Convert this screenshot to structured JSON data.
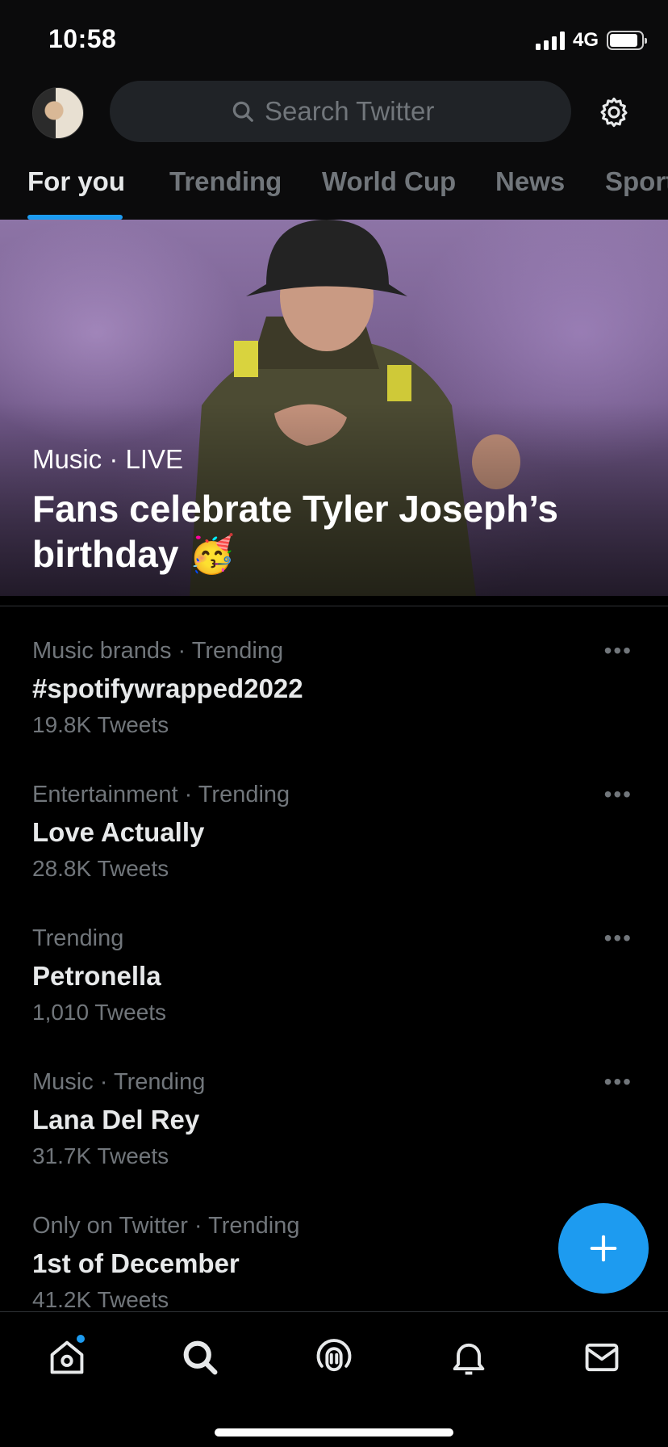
{
  "status_bar": {
    "time": "10:58",
    "network": "4G"
  },
  "header": {
    "search_placeholder": "Search Twitter",
    "tabs": [
      "For you",
      "Trending",
      "World Cup",
      "News",
      "Sport"
    ]
  },
  "hero": {
    "category": "Music",
    "status": "LIVE",
    "meta": "Music · LIVE",
    "title": "Fans celebrate Tyler Joseph’s birthday 🥳"
  },
  "trends": [
    {
      "meta": "Music brands · Trending",
      "title": "#spotifywrapped2022",
      "count": "19.8K Tweets"
    },
    {
      "meta": "Entertainment · Trending",
      "title": "Love Actually",
      "count": "28.8K Tweets"
    },
    {
      "meta": "Trending",
      "title": "Petronella",
      "count": "1,010 Tweets"
    },
    {
      "meta": "Music · Trending",
      "title": "Lana Del Rey",
      "count": "31.7K Tweets"
    },
    {
      "meta": "Only on Twitter · Trending",
      "title": "1st of December",
      "count": "41.2K Tweets"
    }
  ],
  "more_label": "•••",
  "icons": {
    "settings": "gear-icon",
    "fab": "plus-icon",
    "nav": [
      "home-icon",
      "search-icon",
      "spaces-icon",
      "bell-icon",
      "mail-icon"
    ]
  },
  "colors": {
    "accent": "#1d9bf0",
    "background": "#000000",
    "muted": "#71767b"
  }
}
